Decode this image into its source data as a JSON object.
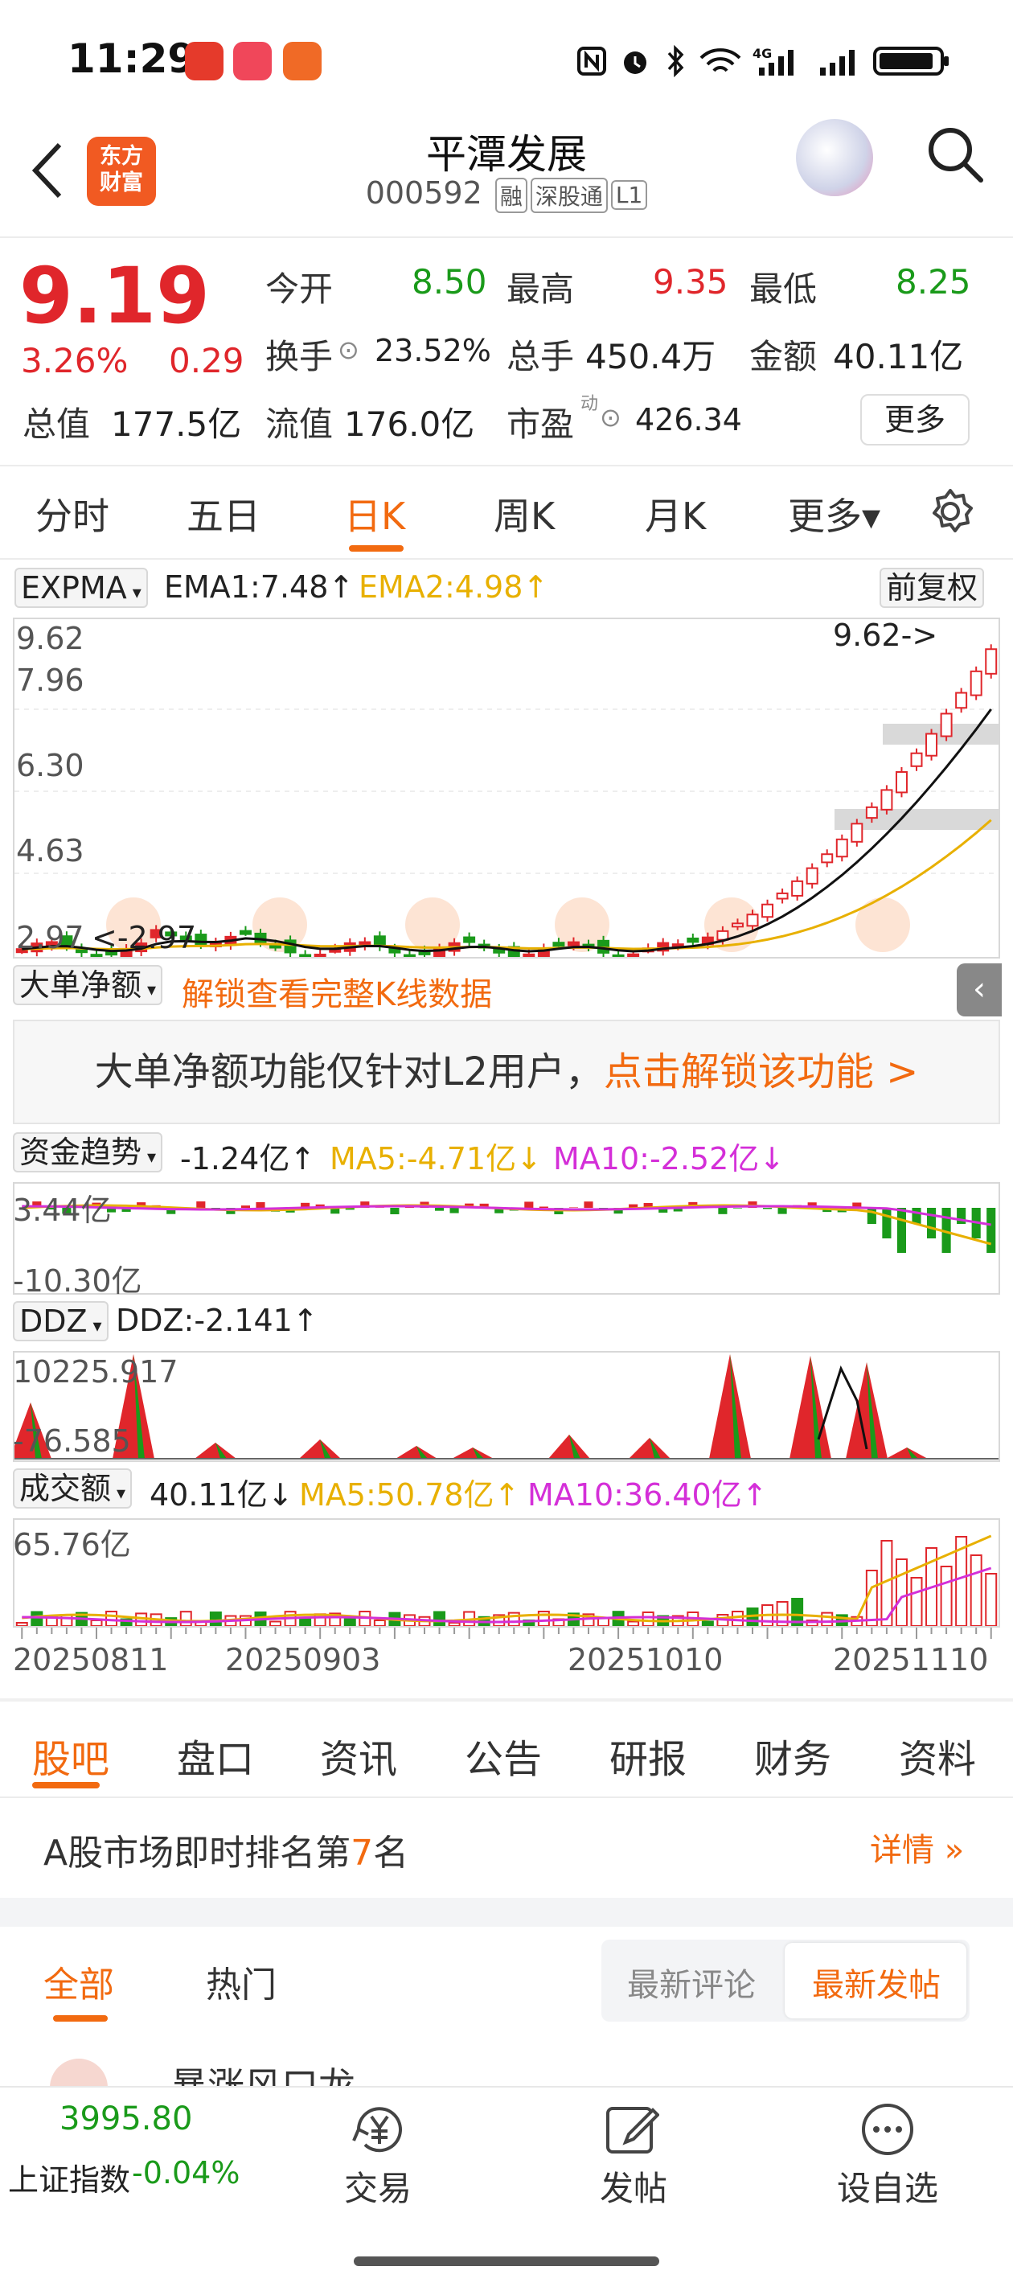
{
  "status_bar": {
    "time": "11:29",
    "network": "4G"
  },
  "header": {
    "logo_line1": "东方",
    "logo_line2": "财富",
    "title": "平潭发展",
    "code": "000592",
    "tags": [
      "融",
      "深股通",
      "L1"
    ]
  },
  "quote": {
    "price": "9.19",
    "change_pct": "3.26%",
    "change": "0.29",
    "open_label": "今开",
    "open": "8.50",
    "high_label": "最高",
    "high": "9.35",
    "low_label": "最低",
    "low": "8.25",
    "turnover_label": "换手",
    "turnover": "23.52%",
    "volume_label": "总手",
    "volume": "450.4万",
    "amount_label": "金额",
    "amount": "40.11亿",
    "mcap_label": "总值",
    "mcap": "177.5亿",
    "float_label": "流值",
    "float": "176.0亿",
    "pe_label": "市盈",
    "pe_sup": "动",
    "pe": "426.34",
    "more_label": "更多"
  },
  "period_tabs": [
    "分时",
    "五日",
    "日K",
    "周K",
    "月K",
    "更多▾"
  ],
  "active_period": "日K",
  "main_chart": {
    "indicator": "EXPMA",
    "ema1": "EMA1:7.48↑",
    "ema2": "EMA2:4.98↑",
    "adjust": "前复权",
    "y_labels": [
      "9.62",
      "7.96",
      "6.30",
      "4.63",
      "2.97"
    ],
    "max_marker": "9.62->",
    "min_marker": "<-2.97"
  },
  "big_order": {
    "selector": "大单净额",
    "unlock_link": "解锁查看完整K线数据",
    "banner_text": "大单净额功能仅针对L2用户，",
    "banner_link": "点击解锁该功能 >"
  },
  "fund_trend": {
    "selector": "资金趋势",
    "value": "-1.24亿↑",
    "ma5": "MA5:-4.71亿↓",
    "ma10": "MA10:-2.52亿↓",
    "y_top": "3.44亿",
    "y_bottom": "-10.30亿"
  },
  "ddz": {
    "selector": "DDZ",
    "value": "DDZ:-2.141↑",
    "y_top": "10225.917",
    "y_bottom": "-76.585"
  },
  "turnover_chart": {
    "selector": "成交额",
    "value": "40.11亿↓",
    "ma5": "MA5:50.78亿↑",
    "ma10": "MA10:36.40亿↑",
    "y_top": "65.76亿",
    "dates": [
      "20250811",
      "20250903",
      "20251010",
      "20251110"
    ]
  },
  "chart_data": {
    "type": "candlestick",
    "title": "",
    "ylim": [
      2.97,
      9.62
    ],
    "dates": [
      "20250811",
      "20250903",
      "20251010",
      "20251110"
    ],
    "last_close": 9.19,
    "high_label": 9.62,
    "low_label": 2.97
  },
  "info_tabs": [
    "股吧",
    "盘口",
    "资讯",
    "公告",
    "研报",
    "财务",
    "资料"
  ],
  "active_info_tab": "股吧",
  "ranking": {
    "prefix": "A股市场即时排名第",
    "rank": "7",
    "suffix": "名",
    "detail": "详情 »"
  },
  "post_tabs": {
    "all": "全部",
    "hot": "热门",
    "latest_comment": "最新评论",
    "latest_post": "最新发帖"
  },
  "post_partial": "暴涨风口龙",
  "bottom_nav": {
    "index_value": "3995.80",
    "index_name": "上证指数",
    "index_change": "-0.04%",
    "trade": "交易",
    "post": "发帖",
    "watchlist": "设自选"
  },
  "colors": {
    "up": "#e0262b",
    "down": "#1a9a1a",
    "accent": "#f26a10",
    "ema2": "#e8b000",
    "ma10": "#d42fd8"
  }
}
